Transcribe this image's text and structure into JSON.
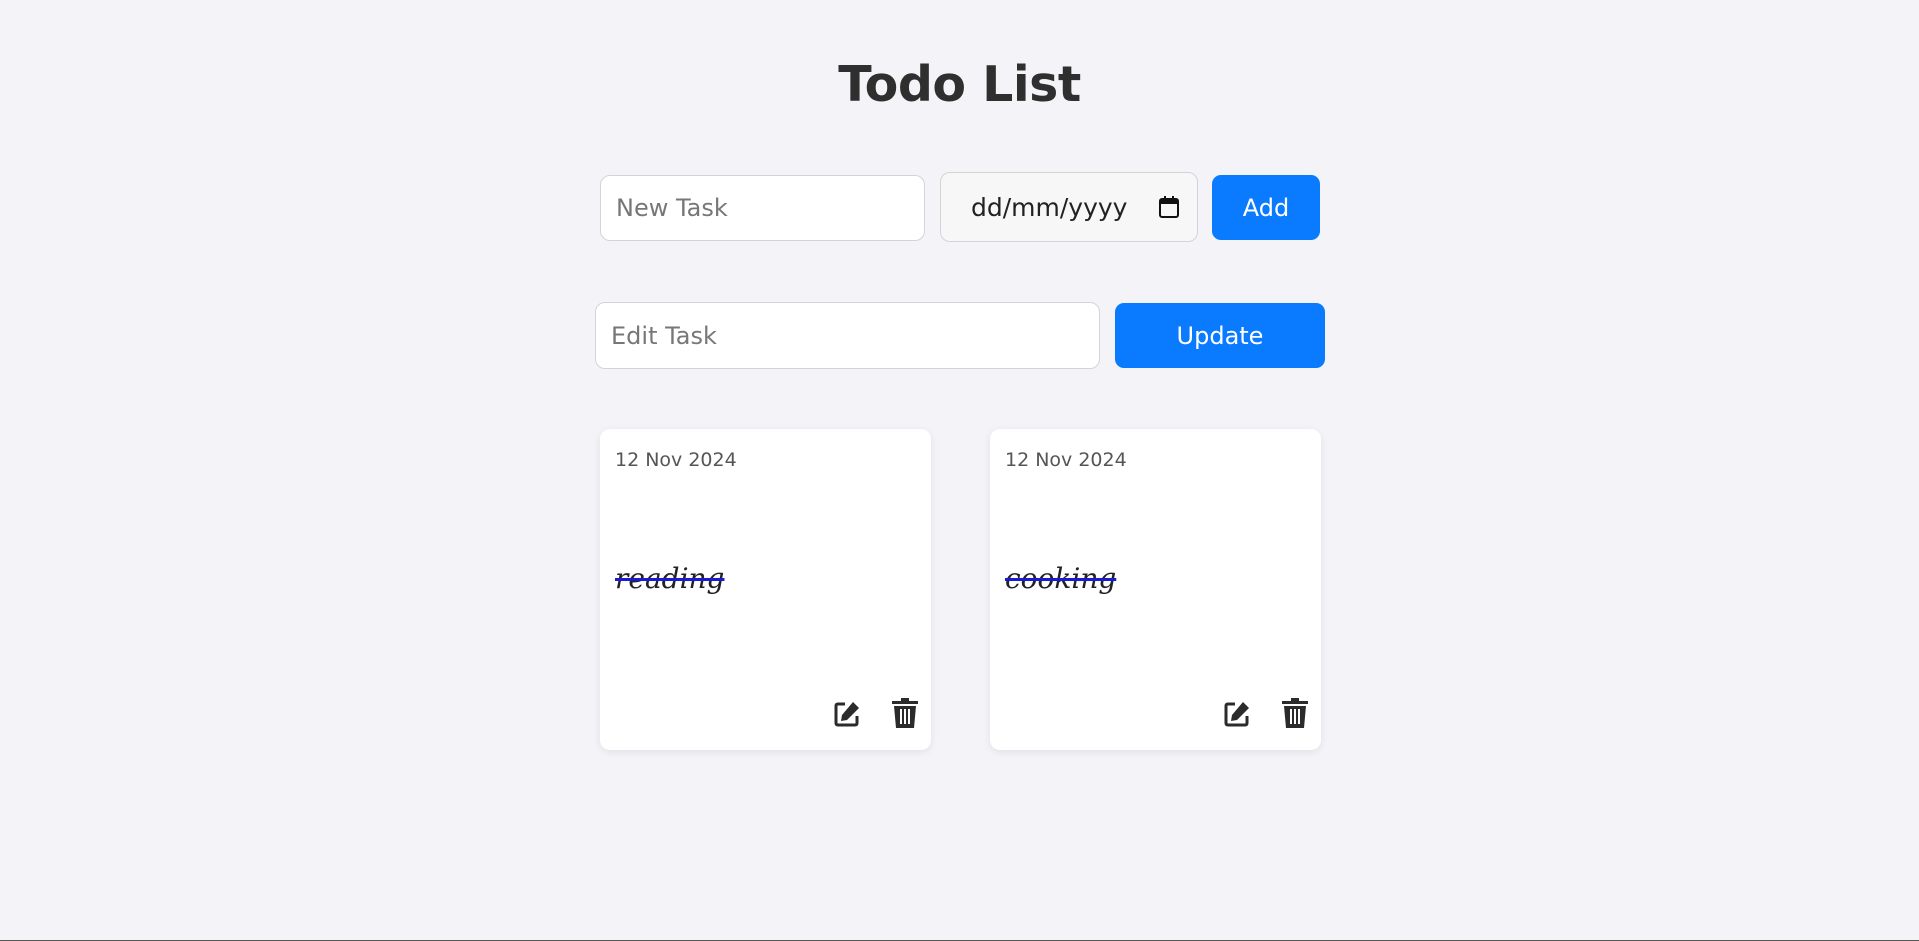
{
  "header": {
    "title": "Todo List"
  },
  "add_form": {
    "task_placeholder": "New Task",
    "date_value": "dd/mm/yyyy",
    "add_label": "Add"
  },
  "edit_form": {
    "task_placeholder": "Edit Task",
    "update_label": "Update"
  },
  "tasks": [
    {
      "date": "12 Nov 2024",
      "text": "reading",
      "completed": true
    },
    {
      "date": "12 Nov 2024",
      "text": "cooking",
      "completed": true
    }
  ],
  "colors": {
    "background": "#f3f3f8",
    "accent": "#0a7bff",
    "strike": "#1a1acf"
  },
  "icons": {
    "date_picker": "calendar-icon",
    "edit": "edit-icon",
    "delete": "trash-icon"
  }
}
